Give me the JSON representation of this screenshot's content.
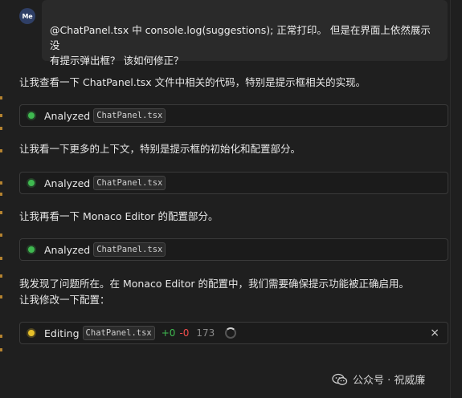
{
  "user": {
    "avatar_label": "Me",
    "message_line1": "@ChatPanel.tsx 中 console.log(suggestions); 正常打印。 但是在界面上依然展示没",
    "message_line2": "有提示弹出框？ 该如何修正？"
  },
  "assistant": {
    "messages": [
      "让我查看一下 ChatPanel.tsx 文件中相关的代码，特别是提示框相关的实现。",
      "让我看一下更多的上下文，特别是提示框的初始化和配置部分。",
      "让我再看一下 Monaco Editor 的配置部分。"
    ],
    "final_line1": "我发现了问题所在。在 Monaco Editor 的配置中，我们需要确保提示功能被正确启用。",
    "final_line2": "让我修改一下配置："
  },
  "tool_calls": [
    {
      "status": "Analyzed",
      "file": "ChatPanel.tsx",
      "status_color": "#3fb950"
    },
    {
      "status": "Analyzed",
      "file": "ChatPanel.tsx",
      "status_color": "#3fb950"
    },
    {
      "status": "Analyzed",
      "file": "ChatPanel.tsx",
      "status_color": "#3fb950"
    }
  ],
  "editing": {
    "status": "Editing",
    "file": "ChatPanel.tsx",
    "added": "+0",
    "removed": "-0",
    "lines": "173",
    "status_color": "#e6c02a",
    "close_icon": "×"
  },
  "watermark": {
    "icon": "wechat-icon",
    "text": "公众号 · 祝威廉"
  }
}
